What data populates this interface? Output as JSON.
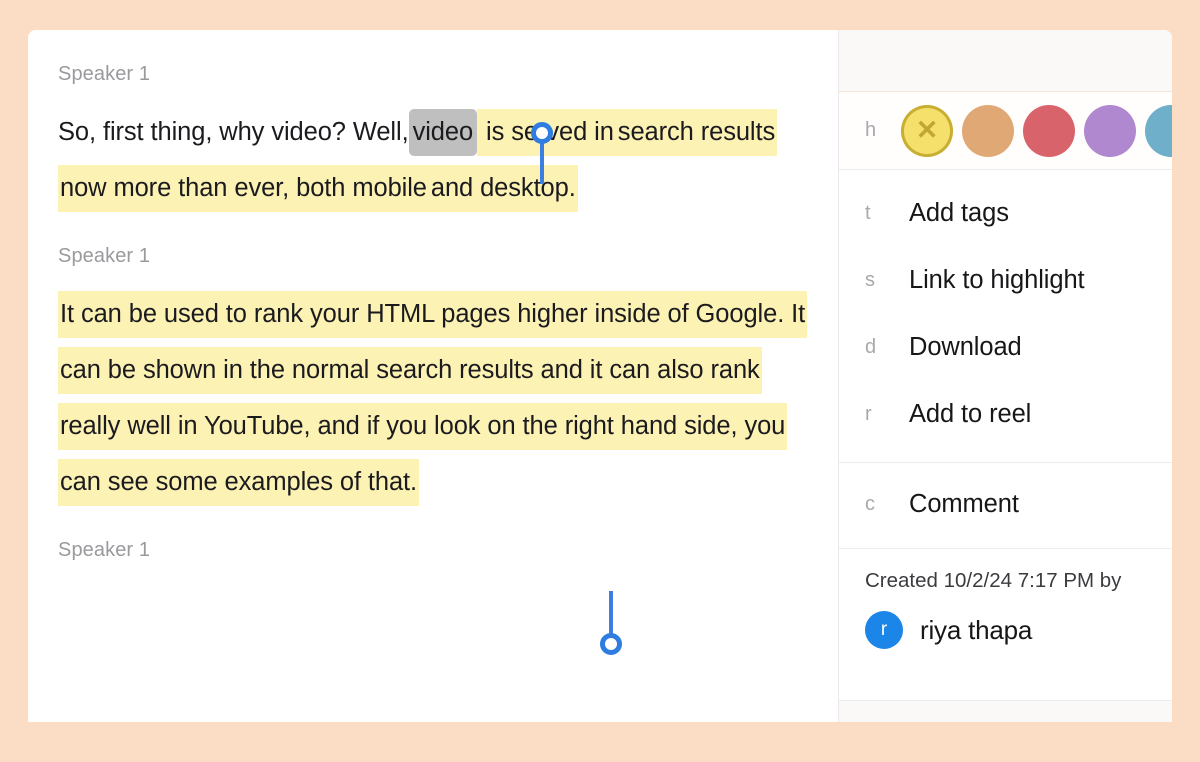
{
  "theme": {
    "frame_color": "#FBDCC4",
    "card_background": "#FFFFFF",
    "highlight_yellow": "#FCF2B4",
    "selection_blue": "#2F7DE1",
    "selected_word_grey": "#BFBFBF",
    "avatar_blue": "#1C86E8"
  },
  "transcript": {
    "blocks": [
      {
        "speaker": "Speaker 1",
        "lines": [
          "So, first thing, why video? Well,",
          "video",
          " is served in",
          "search results now more than ever, both mobile",
          "and desktop."
        ],
        "text_before_selection": "So, first thing, why video? Well,",
        "selected_word": "video",
        "text_after_selection": " is served in search results now more than ever, both mobile and desktop."
      },
      {
        "speaker": "Speaker 1",
        "text": "It can be used to rank your HTML pages higher inside of Google. It can be shown in the normal search results and it can also rank really well in YouTube, and if you look on the right hand side, you can see some examples of that."
      },
      {
        "speaker": "Speaker 1",
        "text": ""
      }
    ]
  },
  "panel": {
    "colors": {
      "shortcut": "h",
      "swatches": [
        {
          "name": "yellow",
          "hex": "#F5E06B",
          "selected": true,
          "glyph": "✕"
        },
        {
          "name": "orange",
          "hex": "#DFA875",
          "selected": false,
          "glyph": ""
        },
        {
          "name": "red",
          "hex": "#D9636A",
          "selected": false,
          "glyph": ""
        },
        {
          "name": "purple",
          "hex": "#B088D0",
          "selected": false,
          "glyph": ""
        },
        {
          "name": "blue",
          "hex": "#6FAFC9",
          "selected": false,
          "glyph": ""
        }
      ]
    },
    "menu": [
      {
        "shortcut": "t",
        "label": "Add tags"
      },
      {
        "shortcut": "s",
        "label": "Link to highlight"
      },
      {
        "shortcut": "d",
        "label": "Download"
      },
      {
        "shortcut": "r",
        "label": "Add to reel"
      }
    ],
    "comment_item": {
      "shortcut": "c",
      "label": "Comment"
    },
    "created": {
      "line": "Created 10/2/24 7:17 PM by",
      "date": "10/2/24",
      "time": "7:17 PM",
      "author_initial": "r",
      "author_name": "riya thapa"
    }
  }
}
